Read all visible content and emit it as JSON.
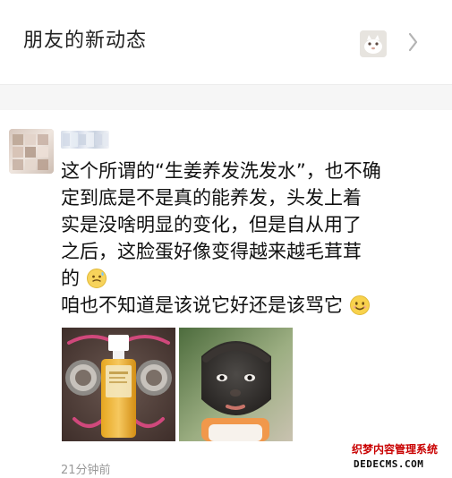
{
  "moments_row": {
    "title": "朋友的新动态",
    "thumb_icon": "cat-photo-thumbnail",
    "chevron_icon": "chevron-right-icon"
  },
  "post": {
    "avatar_icon": "blurred-avatar",
    "nickname_icon": "blurred-nickname",
    "lines": [
      "这个所谓的“生姜养发洗发水”，也不确",
      "定到底是不是真的能养发，头发上着",
      "实是没啥明显的变化，但是自从用了",
      "之后，这脸蛋好像变得越来越毛茸茸",
      "的",
      "咱也不知道是该说它好还是该骂它"
    ],
    "emoji_1": "sweat-emoji",
    "emoji_2": "smile-emoji",
    "timestamp": "21分钟前",
    "photos": [
      "shampoo-bottle-photo",
      "hairy-face-child-photo"
    ]
  },
  "watermark": {
    "cn": "织梦内容管理系统",
    "en": "DEDECMS.COM"
  }
}
